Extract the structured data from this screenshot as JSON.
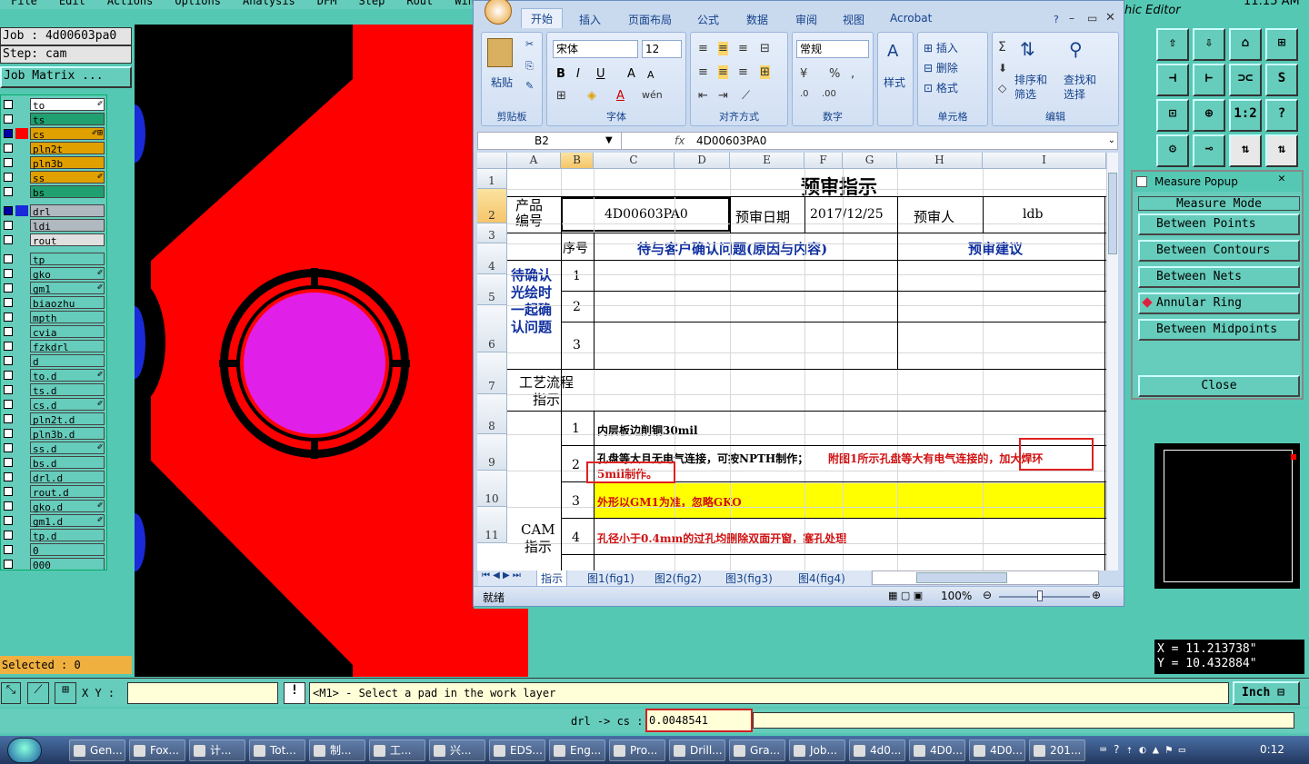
{
  "cam": {
    "menu": [
      "File",
      "Edit",
      "Actions",
      "Options",
      "Analysis",
      "DFM",
      "Step",
      "Rout",
      "Windows"
    ],
    "job": "Job : 4d00603pa0",
    "step": "Step: cam",
    "matrix_button": "Job Matrix ...",
    "layers": [
      {
        "name": "to",
        "color": "#ffffff",
        "on": false,
        "mark": "✐"
      },
      {
        "name": "ts",
        "color": "#20a070",
        "on": false,
        "mark": ""
      },
      {
        "name": "cs",
        "color": "#e0a000",
        "on": true,
        "mark": "✐⊞"
      },
      {
        "name": "pln2t",
        "color": "#e0a000",
        "on": false,
        "mark": ""
      },
      {
        "name": "pln3b",
        "color": "#e0a000",
        "on": false,
        "mark": ""
      },
      {
        "name": "ss",
        "color": "#e0a000",
        "on": false,
        "mark": "✐"
      },
      {
        "name": "bs",
        "color": "#20a070",
        "on": false,
        "mark": ""
      },
      {
        "name": "drl",
        "color": "#b0b8c0",
        "on": true,
        "mark": ""
      },
      {
        "name": "ldi",
        "color": "#b0b8c0",
        "on": false,
        "mark": ""
      },
      {
        "name": "rout",
        "color": "#e0e0e0",
        "on": false,
        "mark": ""
      },
      {
        "name": "tp",
        "color": "#66ccbb",
        "on": false,
        "mark": ""
      },
      {
        "name": "gko",
        "color": "#66ccbb",
        "on": false,
        "mark": "✐"
      },
      {
        "name": "gm1",
        "color": "#66ccbb",
        "on": false,
        "mark": "✐"
      },
      {
        "name": "biaozhu",
        "color": "#66ccbb",
        "on": false,
        "mark": ""
      },
      {
        "name": "mpth",
        "color": "#66ccbb",
        "on": false,
        "mark": ""
      },
      {
        "name": "cvia",
        "color": "#66ccbb",
        "on": false,
        "mark": ""
      },
      {
        "name": "fzkdrl",
        "color": "#66ccbb",
        "on": false,
        "mark": ""
      },
      {
        "name": "d",
        "color": "#66ccbb",
        "on": false,
        "mark": ""
      },
      {
        "name": "to.d",
        "color": "#66ccbb",
        "on": false,
        "mark": "✐"
      },
      {
        "name": "ts.d",
        "color": "#66ccbb",
        "on": false,
        "mark": ""
      },
      {
        "name": "cs.d",
        "color": "#66ccbb",
        "on": false,
        "mark": "✐"
      },
      {
        "name": "pln2t.d",
        "color": "#66ccbb",
        "on": false,
        "mark": ""
      },
      {
        "name": "pln3b.d",
        "color": "#66ccbb",
        "on": false,
        "mark": ""
      },
      {
        "name": "ss.d",
        "color": "#66ccbb",
        "on": false,
        "mark": "✐"
      },
      {
        "name": "bs.d",
        "color": "#66ccbb",
        "on": false,
        "mark": ""
      },
      {
        "name": "drl.d",
        "color": "#66ccbb",
        "on": false,
        "mark": ""
      },
      {
        "name": "rout.d",
        "color": "#66ccbb",
        "on": false,
        "mark": ""
      },
      {
        "name": "gko.d",
        "color": "#66ccbb",
        "on": false,
        "mark": "✐"
      },
      {
        "name": "gm1.d",
        "color": "#66ccbb",
        "on": false,
        "mark": "✐"
      },
      {
        "name": "tp.d",
        "color": "#66ccbb",
        "on": false,
        "mark": ""
      },
      {
        "name": "0",
        "color": "#66ccbb",
        "on": false,
        "mark": ""
      },
      {
        "name": "000",
        "color": "#66ccbb",
        "on": false,
        "mark": ""
      }
    ],
    "selected": "Selected : 0",
    "graphic_editor_title": "hic Editor",
    "time": "11:15 AM",
    "xy_label": "X Y :",
    "xy_value": "",
    "prompt": "<M1> - Select a pad in the work layer",
    "units_button": "Inch",
    "status_label": "drl -> cs :",
    "status_value": "0.0048541",
    "coord_x": "X = 11.213738\"",
    "coord_y": "Y = 10.432884\""
  },
  "toolbar_icons": [
    "⇧",
    "⇩",
    "⌂",
    "⊞",
    "⊣",
    "⊢",
    "⊃⊂",
    "S",
    "⊡",
    "⊕",
    "1:2",
    "?",
    "⚙",
    "⊸",
    "⇅",
    "⇅"
  ],
  "measure_popup": {
    "title": "Measure Popup",
    "section": "Measure Mode",
    "options": [
      "Between Points",
      "Between Contours",
      "Between Nets",
      "Annular Ring",
      "Between Midpoints"
    ],
    "active_index": 3,
    "close": "Close"
  },
  "excel": {
    "tabs": [
      "开始",
      "插入",
      "页面布局",
      "公式",
      "数据",
      "审阅",
      "视图",
      "Acrobat"
    ],
    "groups": [
      "剪贴板",
      "字体",
      "对齐方式",
      "数字",
      "单元格",
      "编辑"
    ],
    "paste": "粘贴",
    "font_name": "宋体",
    "font_size": "12",
    "number_format": "常规",
    "style_label": "样式",
    "insert": "插入",
    "delete": "删除",
    "format": "格式",
    "sort_filter": "排序和\n筛选",
    "find_select": "查找和\n选择",
    "name_box": "B2",
    "fx": "fx",
    "formula": "4D00603PA0",
    "columns": [
      "A",
      "B",
      "C",
      "D",
      "E",
      "F",
      "G",
      "H",
      "I"
    ],
    "rows": [
      "1",
      "2",
      "3",
      "4",
      "5",
      "6",
      "7",
      "8",
      "9",
      "10",
      "11"
    ],
    "title": "预审指示",
    "product_label": "产品\n编号",
    "product_value": "4D00603PA0",
    "date_label": "预审日期",
    "date_value": "2017/12/25",
    "reviewer_label": "预审人",
    "reviewer_value": "ldb",
    "seq_label": "序号",
    "issue_header": "待与客户确认问题(原因与内容)",
    "suggest_header": "预审建议",
    "pending_label": "待确认\n光绘时\n一起确\n认问题",
    "seq": [
      "1",
      "2",
      "3"
    ],
    "process_label": "工艺流程\n指示",
    "cam_label": "CAM\n指示",
    "cam_items": [
      {
        "n": "1",
        "text": "内层板边削铜30mil"
      },
      {
        "n": "2",
        "text": "孔盘等大且无电气连接，可按NPTH制作；",
        "text_red": "附图1所示孔盘等大有电气连接的，加大焊环",
        "text_red2": "5mil制作。"
      },
      {
        "n": "3",
        "text": "外形以GM1为准，忽略GKO"
      },
      {
        "n": "4",
        "text": "孔径小于0.4mm的过孔均删除双面开窗，塞孔处理"
      }
    ],
    "sheet_tabs": [
      "指示",
      "图1(fig1)",
      "图2(fig2)",
      "图3(fig3)",
      "图4(fig4)"
    ],
    "status": "就绪",
    "zoom": "100%"
  },
  "taskbar": {
    "items": [
      "Gen...",
      "Fox...",
      "计...",
      "Tot...",
      "制...",
      "工...",
      "兴...",
      "EDS...",
      "Eng...",
      "Pro...",
      "Drill...",
      "Gra...",
      "Job...",
      "4d0...",
      "4D0...",
      "4D0...",
      "201..."
    ],
    "clock": "0:12"
  }
}
